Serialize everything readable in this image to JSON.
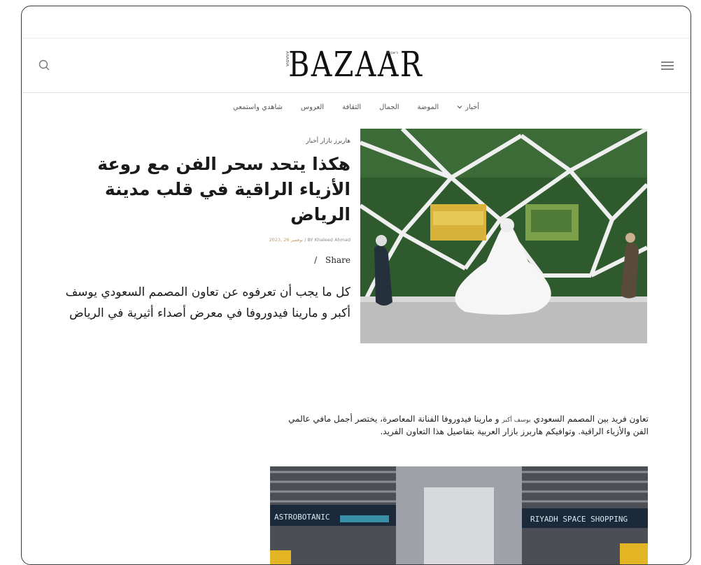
{
  "header": {
    "logo": "BAZAAR",
    "logo_left_tiny": "ARABIA",
    "logo_right_tiny": "Harper's",
    "search_icon": "search-icon",
    "menu_icon": "hamburger-menu-icon"
  },
  "nav": {
    "items": [
      {
        "label": "أخبار"
      },
      {
        "label": "الموضة"
      },
      {
        "label": "الجمال"
      },
      {
        "label": "الثقافة"
      },
      {
        "label": "العروس"
      },
      {
        "label": "شاهدي واستمعي"
      }
    ]
  },
  "article": {
    "kicker": "هاربرز بازار أخبار",
    "headline": "هكذا يتحد سحر الفن مع روعة الأزياء الراقية في قلب مدينة الرياض",
    "byline_author": "BY Khaleed Ahmad",
    "byline_sep": "/",
    "byline_date": "نوفمبر 26 ,2023",
    "share_label": "Share",
    "share_slash": "/",
    "dek": "كل ما يجب أن تعرفوه عن تعاون المصمم السعودي يوسف أكبر و مارينا فيدوروفا في معرض أصداء أثيرية في الرياض"
  },
  "body": {
    "para_start": "تعاون فريد بين المصمم السعودي ",
    "para_small": "يوسف أكبر",
    "para_end": " و مارينا فيدوروفا الفنانة المعاصرة، يختصر أجمل مافي عالمي الفن والأزياء الراقية. وتوافيكم هاربرز بازار العربية بتفاصيل هذا التعاون الفريد."
  },
  "photo2": {
    "sign_left": "ASTROBOTANIC",
    "sign_right": "RIYADH SPACE SHOPPING"
  },
  "colors": {
    "green_wall": "#2f5a2e",
    "white_frame": "#e9e9e9",
    "date_accent": "#c19b6b"
  }
}
